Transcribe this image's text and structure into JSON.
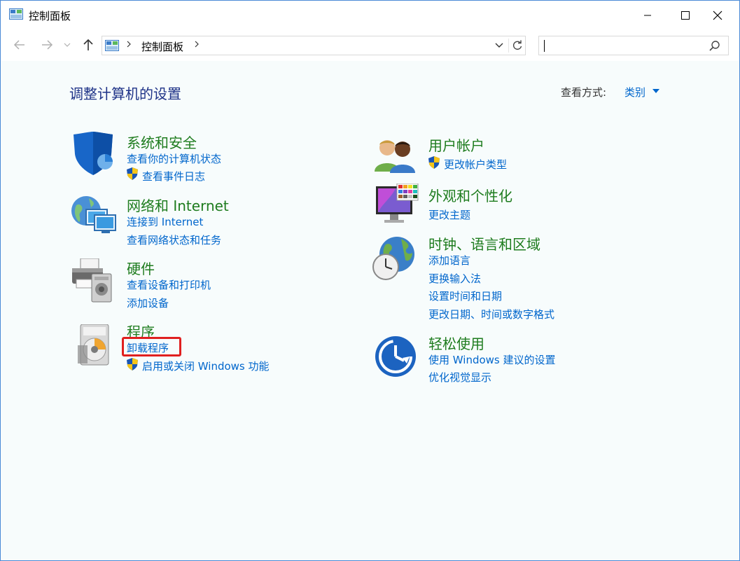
{
  "window": {
    "title": "控制面板",
    "controls": [
      "minimize",
      "maximize",
      "close"
    ]
  },
  "nav": {
    "back_icon": "arrow-left-icon",
    "forward_icon": "arrow-right-icon",
    "recent_icon": "chevron-down-icon",
    "up_icon": "arrow-up-icon",
    "address": {
      "icon": "control-panel-icon",
      "path": [
        "控制面板"
      ]
    },
    "search": {
      "placeholder": "",
      "icon": "search-icon"
    }
  },
  "main": {
    "title": "调整计算机的设置",
    "view_label": "查看方式:",
    "view_value": "类别",
    "left_categories": [
      {
        "icon": "security-shield-icon",
        "title": "系统和安全",
        "links": [
          {
            "label": "查看你的计算机状态",
            "shield": false
          },
          {
            "label": "查看事件日志",
            "shield": true
          }
        ]
      },
      {
        "icon": "network-globe-icon",
        "title": "网络和 Internet",
        "links": [
          {
            "label": "连接到 Internet",
            "shield": false
          },
          {
            "label": "查看网络状态和任务",
            "shield": false
          }
        ]
      },
      {
        "icon": "printer-icon",
        "title": "硬件",
        "links": [
          {
            "label": "查看设备和打印机",
            "shield": false
          },
          {
            "label": "添加设备",
            "shield": false
          }
        ]
      },
      {
        "icon": "programs-disc-icon",
        "title": "程序",
        "links": [
          {
            "label": "卸载程序",
            "shield": false,
            "highlighted": true
          },
          {
            "label": "启用或关闭 Windows 功能",
            "shield": true
          }
        ]
      }
    ],
    "right_categories": [
      {
        "icon": "users-icon",
        "title": "用户帐户",
        "links": [
          {
            "label": "更改帐户类型",
            "shield": true
          }
        ]
      },
      {
        "icon": "appearance-monitor-icon",
        "title": "外观和个性化",
        "links": [
          {
            "label": "更改主题",
            "shield": false
          }
        ]
      },
      {
        "icon": "clock-globe-icon",
        "title": "时钟、语言和区域",
        "links": [
          {
            "label": "添加语言",
            "shield": false
          },
          {
            "label": "更换输入法",
            "shield": false
          },
          {
            "label": "设置时间和日期",
            "shield": false
          },
          {
            "label": "更改日期、时间或数字格式",
            "shield": false
          }
        ]
      },
      {
        "icon": "ease-of-access-icon",
        "title": "轻松使用",
        "links": [
          {
            "label": "使用 Windows 建议的设置",
            "shield": false
          },
          {
            "label": "优化视觉显示",
            "shield": false
          }
        ]
      }
    ]
  },
  "colors": {
    "title_text": "#1e3287",
    "category_title": "#1e7c1e",
    "link": "#0066cc",
    "highlight": "#e02020",
    "content_bg": "#f7fcfc"
  }
}
